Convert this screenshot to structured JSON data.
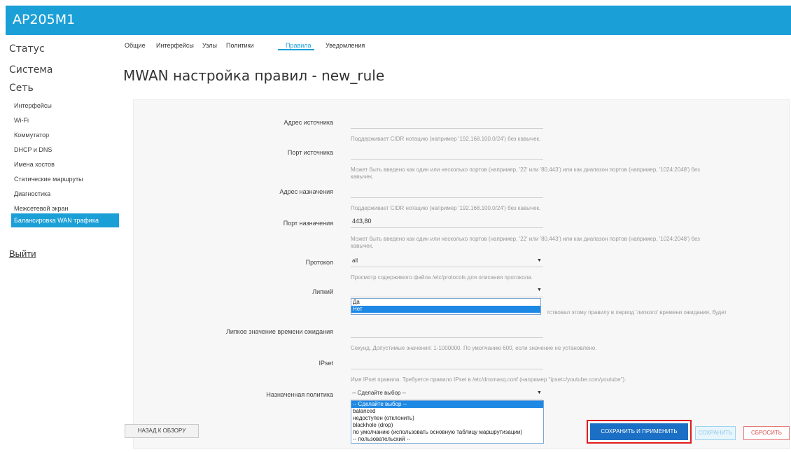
{
  "app": {
    "title": "AP205M1"
  },
  "sidebar": {
    "main": [
      "Статус",
      "Система",
      "Сеть"
    ],
    "items": [
      "Интерфейсы",
      "Wi-Fi",
      "Коммутатор",
      "DHCP и DNS",
      "Имена хостов",
      "Статические маршруты",
      "Диагностика",
      "Межсетевой экран",
      "Балансировка WAN трафика"
    ],
    "active_item": "Балансировка WAN трафика",
    "logout": "Выйти"
  },
  "tabs": [
    "Общие",
    "Интерфейсы",
    "Узлы",
    "Политики",
    "Правила",
    "Уведомления"
  ],
  "active_tab": "Правила",
  "page_title": "MWAN настройка правил - new_rule",
  "form": {
    "src_addr": {
      "label": "Адрес источника",
      "value": "",
      "hint": "Поддерживает CIDR нотацию (например '192.168.100.0/24') без кавычек."
    },
    "src_port": {
      "label": "Порт источника",
      "value": "",
      "hint1": "Может быть введено как один или несколько портов (например, '22' или '80,443') или как диапазон портов (например, '1024:2048') без",
      "hint2": "кавычек."
    },
    "dst_addr": {
      "label": "Адрес назначения",
      "value": "",
      "hint": "Поддерживает CIDR нотацию (например '192.168.100.0/24') без кавычек."
    },
    "dst_port": {
      "label": "Порт назначения",
      "value": "443,80",
      "hint1": "Может быть введено как один или несколько портов (например, '22' или '80,443') или как диапазон портов (например, '1024:2048') без",
      "hint2": "кавычек."
    },
    "protocol": {
      "label": "Протокол",
      "value": "all",
      "hint": "Просмотр содержимого файла /etc/protocols для описания протокола."
    },
    "sticky": {
      "label": "Липкий",
      "value": "",
      "options": [
        "Да",
        "Нет"
      ],
      "selected": "Нет",
      "hint_visible": "тствовал этому правилу в период 'липкого' времени ожидания, будет"
    },
    "sticky_timeout": {
      "label": "Липкое значение времени ожидания",
      "value": "",
      "hint": "Секунд. Допустимые значения: 1-1000000. По умолчанию 600, если значение не установлено."
    },
    "ipset": {
      "label": "IPset",
      "value": "",
      "hint": "Имя IPset правила. Требуется правило IPset в /etc/dnsmasq.conf (например \"ipset=/youtube.com/youtube\")."
    },
    "policy": {
      "label": "Назначенная политика",
      "value": "-- Сделайте выбор --",
      "options": [
        "-- Сделайте выбор --",
        "balanced",
        "недоступен (отклонить)",
        "blackhole (drop)",
        "по умолчанию (использовать основную таблицу маршрутизации)",
        "-- пользовательский --"
      ],
      "selected": "-- Сделайте выбор --"
    }
  },
  "buttons": {
    "back": "НАЗАД К ОБЗОРУ",
    "save_apply": "СОХРАНИТЬ И ПРИМЕНИТЬ",
    "save": "СОХРАНИТЬ",
    "reset": "СБРОСИТЬ"
  },
  "colors": {
    "accent": "#1b9fd7",
    "highlight": "#e01b1b",
    "apply_button": "#1b6fc4"
  }
}
